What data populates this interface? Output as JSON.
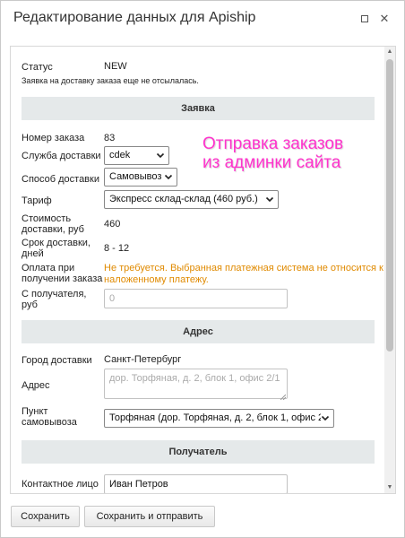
{
  "window": {
    "title": "Редактирование данных для Apiship"
  },
  "status": {
    "label": "Статус",
    "value": "NEW",
    "note": "Заявка на доставку заказа еще не отсылалась."
  },
  "sections": {
    "order": "Заявка",
    "address": "Адрес",
    "recipient": "Получатель"
  },
  "order": {
    "number_label": "Номер заказа",
    "number_value": "83",
    "service_label": "Служба доставки",
    "service_value": "cdek",
    "method_label": "Способ доставки",
    "method_value": "Самовывоз",
    "tariff_label": "Тариф",
    "tariff_value": "Экспресс склад-склад (460 руб.)",
    "cost_label_1": "Стоимость",
    "cost_label_2": "доставки, руб",
    "cost_value": "460",
    "term_label_1": "Срок доставки,",
    "term_label_2": "дней",
    "term_value": "8 - 12",
    "payment_label_1": "Оплата при",
    "payment_label_2": "получении заказа",
    "payment_warning_1": "Не требуется. Выбранная платежная система не относится к",
    "payment_warning_2": "наложенному платежу.",
    "cod_label_1": "С получателя,",
    "cod_label_2": "руб",
    "cod_placeholder": "0"
  },
  "address": {
    "city_label": "Город доставки",
    "city_value": "Санкт-Петербург",
    "address_label": "Адрес",
    "address_placeholder": "дор. Торфяная, д. 2, блок 1, офис 2/1",
    "pickup_label_1": "Пункт",
    "pickup_label_2": "самовывоза",
    "pickup_value": "Торфяная (дор. Торфяная, д. 2, блок 1, офис 2"
  },
  "recipient": {
    "contact_label": "Контактное лицо",
    "contact_value": "Иван Петров"
  },
  "overlay": {
    "line1": "Отправка заказов",
    "line2": "из админки сайта"
  },
  "buttons": {
    "save": "Сохранить",
    "save_send": "Сохранить и отправить"
  },
  "colors": {
    "warning": "#e08a00",
    "overlay_text": "#ff33cc",
    "section_header_bg": "#e5e9ea"
  }
}
